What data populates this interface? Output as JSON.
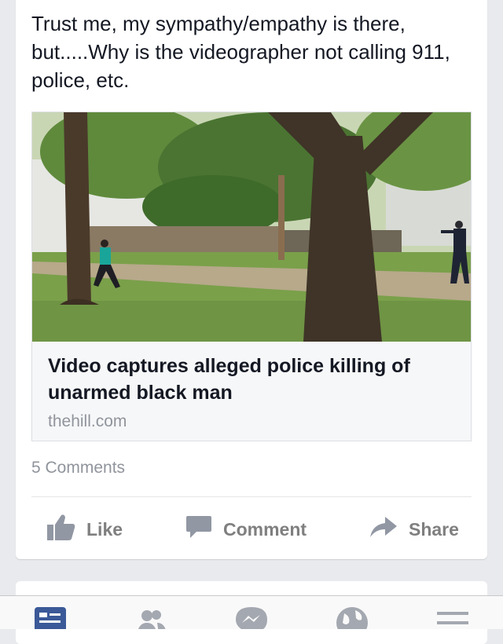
{
  "post": {
    "text": "Trust me, my sympathy/empathy is there, but.....Why is the videographer not calling 911, police, etc."
  },
  "link": {
    "image_icon": "photo-park-scene",
    "title": "Video captures alleged police killing of unarmed black man",
    "domain": "thehill.com"
  },
  "comments_count": "5 Comments",
  "actions": {
    "like_label": "Like",
    "comment_label": "Comment",
    "share_label": "Share"
  },
  "tabbar": {
    "items": [
      "news-feed-icon",
      "friend-requests-icon",
      "messenger-icon",
      "notifications-icon",
      "more-menu-icon"
    ],
    "active": "news-feed-icon"
  },
  "colors": {
    "accent": "#3b5998",
    "text": "#141823",
    "muted": "#90949c"
  }
}
